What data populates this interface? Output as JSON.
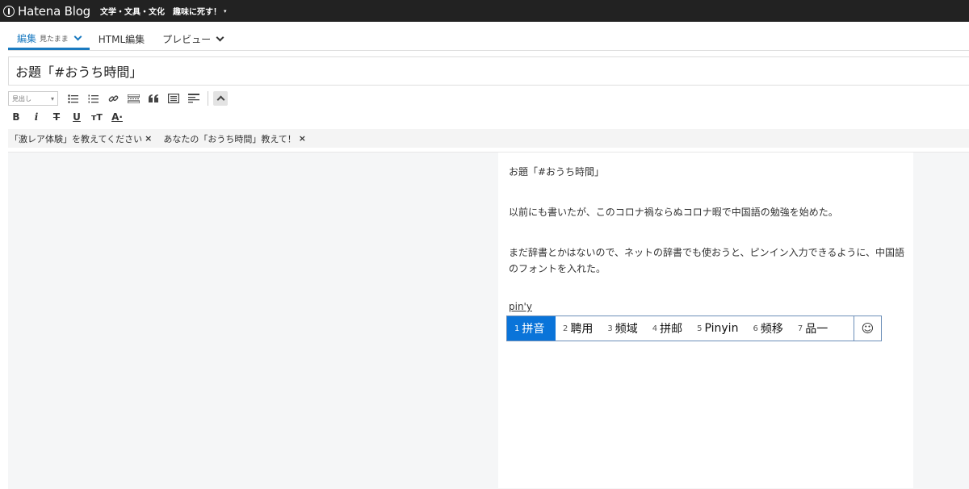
{
  "topbar": {
    "logo": "Hatena Blog",
    "blog_name": "文学・文具・文化　趣味に死す！",
    "caret": "▾"
  },
  "tabs": [
    {
      "label": "編集",
      "sub": "見たまま"
    },
    {
      "label": "HTML編集"
    },
    {
      "label": "プレビュー"
    }
  ],
  "title": "お題「#おうち時間」",
  "toolbar": {
    "heading_select": "見出し",
    "heading_caret": "▾"
  },
  "format": {
    "bold": "B",
    "italic": "i",
    "strike": "T",
    "underline": "U",
    "size": "тT",
    "color": "A·"
  },
  "topics": [
    {
      "label": "「激レア体験」を教えてください",
      "close": "×"
    },
    {
      "label": "あなたの「おうち時間」教えて！",
      "close": "×"
    }
  ],
  "document": {
    "paragraphs": [
      "お題「#おうち時間」",
      "以前にも書いたが、このコロナ禍ならぬコロナ暇で中国語の勉強を始めた。",
      "まだ辞書とかはないので、ネットの辞書でも使おうと、ピンイン入力できるように、中国語のフォントを入れた。"
    ]
  },
  "ime": {
    "composition": "pin'y",
    "candidates": [
      {
        "num": "1",
        "text": "拼音"
      },
      {
        "num": "2",
        "text": "聘用"
      },
      {
        "num": "3",
        "text": "频域"
      },
      {
        "num": "4",
        "text": "拼邮"
      },
      {
        "num": "5",
        "text": "Pinyin"
      },
      {
        "num": "6",
        "text": "频移"
      },
      {
        "num": "7",
        "text": "品一"
      }
    ],
    "emoji": "☺"
  }
}
